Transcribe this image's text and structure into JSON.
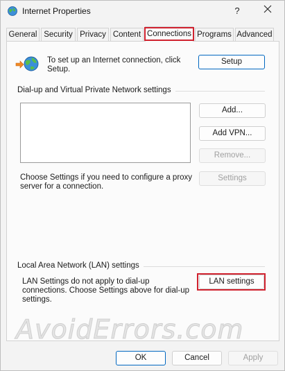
{
  "window": {
    "title": "Internet Properties",
    "help_label": "?",
    "close_label": "✕"
  },
  "tabs": [
    {
      "label": "General"
    },
    {
      "label": "Security"
    },
    {
      "label": "Privacy"
    },
    {
      "label": "Content"
    },
    {
      "label": "Connections",
      "active": true
    },
    {
      "label": "Programs"
    },
    {
      "label": "Advanced"
    }
  ],
  "setup": {
    "text": "To set up an Internet connection, click Setup.",
    "button_label": "Setup"
  },
  "dialup": {
    "section_label": "Dial-up and Virtual Private Network settings",
    "add_label": "Add...",
    "add_vpn_label": "Add VPN...",
    "remove_label": "Remove...",
    "proxy_text": "Choose Settings if you need to configure a proxy server for a connection.",
    "settings_label": "Settings"
  },
  "lan": {
    "section_label": "Local Area Network (LAN) settings",
    "text": "LAN Settings do not apply to dial-up connections. Choose Settings above for dial-up settings.",
    "button_label": "LAN settings"
  },
  "footer": {
    "ok_label": "OK",
    "cancel_label": "Cancel",
    "apply_label": "Apply"
  },
  "watermark": "AvoidErrors.com",
  "colors": {
    "highlight": "#d0212e",
    "accent": "#0067c0"
  },
  "icons": [
    "internet-properties-icon",
    "help-icon",
    "close-icon",
    "globe-connection-icon"
  ]
}
